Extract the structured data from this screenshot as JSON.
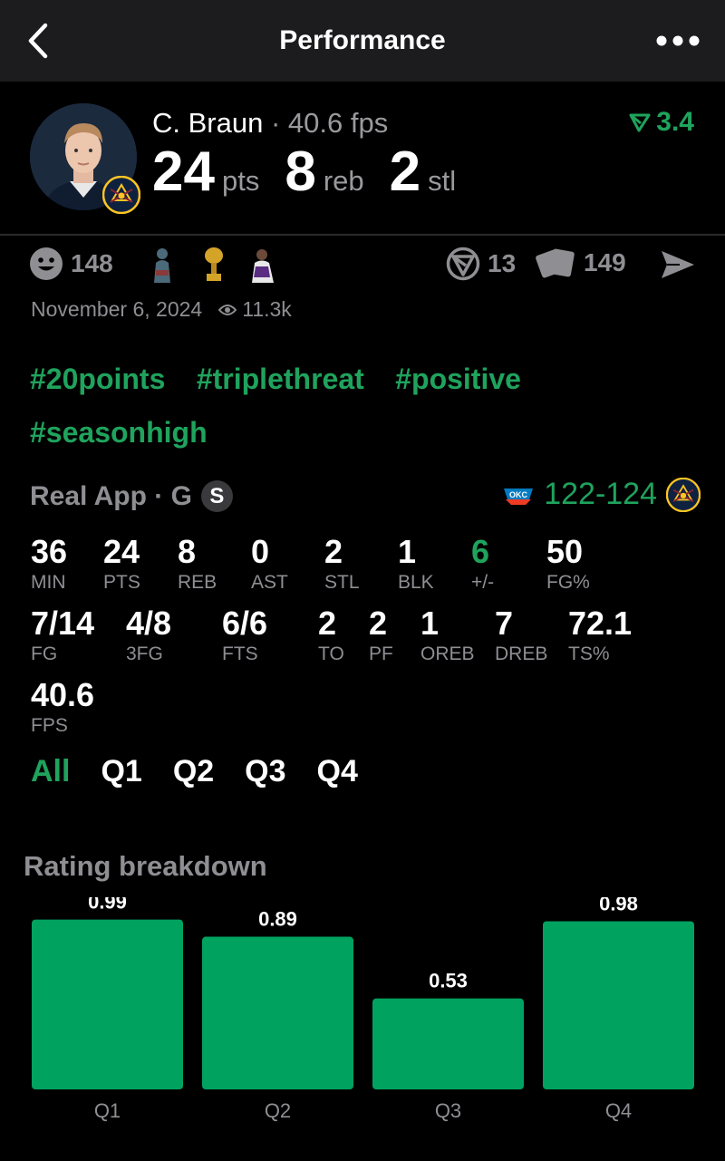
{
  "nav": {
    "title": "Performance"
  },
  "player": {
    "name": "C. Braun",
    "fps": "· 40.6 fps",
    "rating_change": "3.4",
    "big_stats": [
      {
        "num": "24",
        "unit": "pts"
      },
      {
        "num": "8",
        "unit": "reb"
      },
      {
        "num": "2",
        "unit": "stl"
      }
    ]
  },
  "social": {
    "reactions": "148",
    "comments": "13",
    "cards": "149"
  },
  "meta": {
    "date": "November 6, 2024",
    "views": "11.3k"
  },
  "tags": [
    "#20points",
    "#triplethreat",
    "#positive",
    "#seasonhigh"
  ],
  "game": {
    "source": "Real App · G",
    "badge": "S",
    "score": "122-124"
  },
  "stats": [
    {
      "v": "36",
      "l": "MIN"
    },
    {
      "v": "24",
      "l": "PTS"
    },
    {
      "v": "8",
      "l": "REB"
    },
    {
      "v": "0",
      "l": "AST"
    },
    {
      "v": "2",
      "l": "STL"
    },
    {
      "v": "1",
      "l": "BLK"
    },
    {
      "v": "6",
      "l": "+/-"
    },
    {
      "v": "50",
      "l": "FG%"
    },
    {
      "v": "7/14",
      "l": "FG"
    },
    {
      "v": "4/8",
      "l": "3FG"
    },
    {
      "v": "6/6",
      "l": "FTS"
    },
    {
      "v": "2",
      "l": "TO"
    },
    {
      "v": "2",
      "l": "PF"
    },
    {
      "v": "1",
      "l": "OREB"
    },
    {
      "v": "7",
      "l": "DREB"
    },
    {
      "v": "72.1",
      "l": "TS%"
    },
    {
      "v": "40.6",
      "l": "FPS"
    }
  ],
  "quarter_tabs": [
    "All",
    "Q1",
    "Q2",
    "Q3",
    "Q4"
  ],
  "rating_breakdown": {
    "title": "Rating breakdown"
  },
  "chart_data": {
    "type": "bar",
    "categories": [
      "Q1",
      "Q2",
      "Q3",
      "Q4"
    ],
    "values": [
      0.99,
      0.89,
      0.53,
      0.98
    ],
    "value_labels": [
      "0.99",
      "0.89",
      "0.53",
      "0.98"
    ],
    "ylim": [
      0,
      1.12
    ],
    "bar_color": "#00a260",
    "grid": false
  },
  "colors": {
    "accent": "#1fa35d",
    "muted": "#8e8e93",
    "topbar": "#1c1c1e"
  }
}
